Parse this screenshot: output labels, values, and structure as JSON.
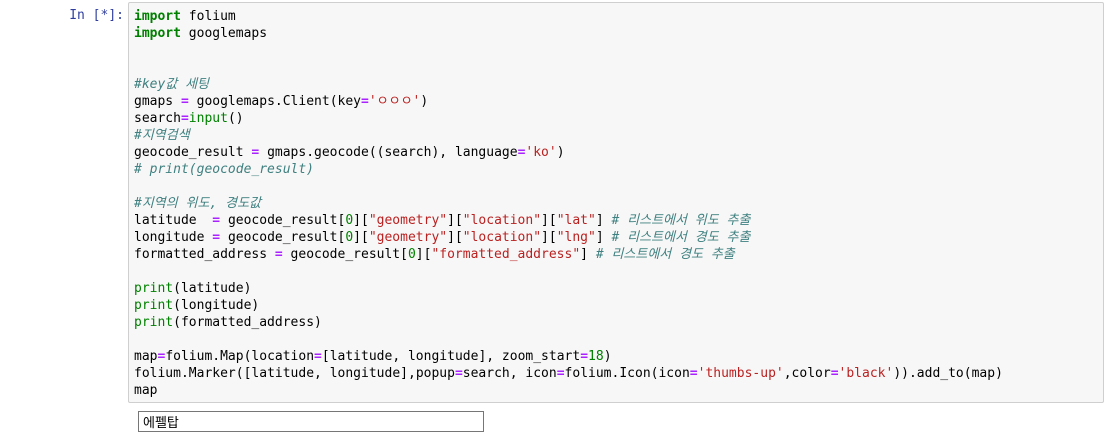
{
  "cell": {
    "prompt": "In [*]:",
    "code_lines": [
      "import folium",
      "import googlemaps",
      "",
      "",
      "#key값 세팅",
      "gmaps = googlemaps.Client(key='ㅇㅇㅇ')",
      "search=input()",
      "#지역검색",
      "geocode_result = gmaps.geocode((search), language='ko')",
      "# print(geocode_result)",
      "",
      "#지역의 위도, 경도값",
      "latitude  = geocode_result[0][\"geometry\"][\"location\"][\"lat\"] # 리스트에서 위도 추출",
      "longitude = geocode_result[0][\"geometry\"][\"location\"][\"lng\"] # 리스트에서 경도 추출",
      "formatted_address = geocode_result[0][\"formatted_address\"] # 리스트에서 경도 추출",
      "",
      "print(latitude)",
      "print(longitude)",
      "print(formatted_address)",
      "",
      "map=folium.Map(location=[latitude, longitude], zoom_start=18)",
      "folium.Marker([latitude, longitude],popup=search, icon=folium.Icon(icon='thumbs-up',color='black')).add_to(map)",
      "map"
    ]
  },
  "stdin_input": {
    "value": "에펠탑"
  }
}
